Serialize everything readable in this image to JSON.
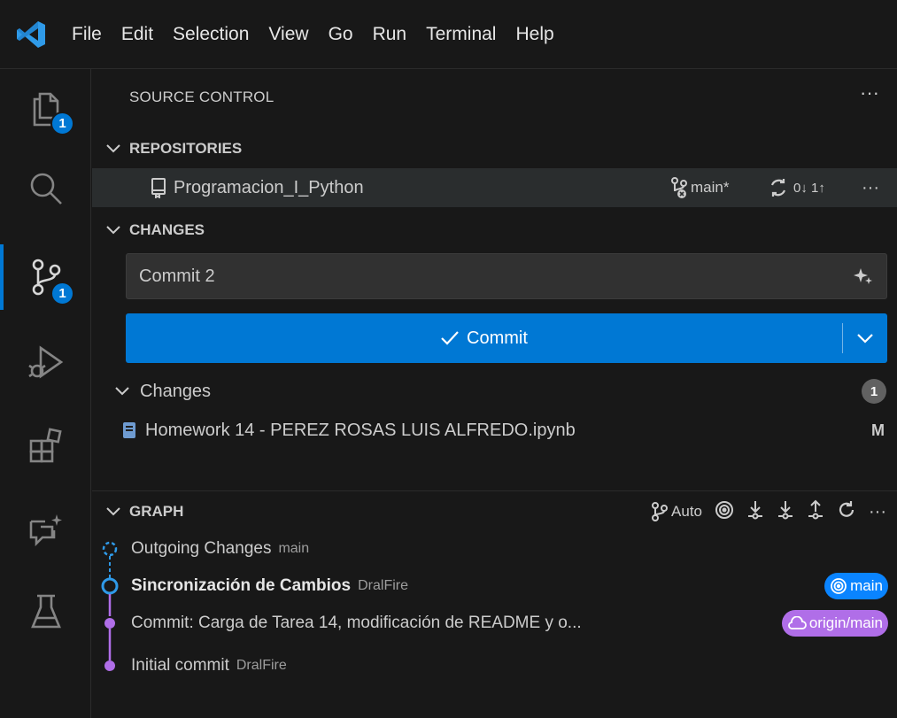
{
  "menu": [
    "File",
    "Edit",
    "Selection",
    "View",
    "Go",
    "Run",
    "Terminal",
    "Help"
  ],
  "activity": {
    "explorer_badge": "1",
    "scm_badge": "1"
  },
  "sidebar": {
    "title": "SOURCE CONTROL",
    "more": "···"
  },
  "repositories": {
    "header": "REPOSITORIES",
    "repo_name": "Programacion_I_Python",
    "branch": "main*",
    "sync": "0↓ 1↑",
    "more": "···"
  },
  "changes": {
    "header": "CHANGES",
    "commit_message": "Commit 2",
    "commit_label": "Commit",
    "group_label": "Changes",
    "count": "1",
    "files": [
      {
        "name": "Homework 14 - PEREZ ROSAS LUIS ALFREDO.ipynb",
        "status": "M"
      }
    ]
  },
  "graph": {
    "header": "GRAPH",
    "auto_label": "Auto",
    "more": "···",
    "rows": [
      {
        "message": "Outgoing Changes",
        "author": "main",
        "bold": false
      },
      {
        "message": "Sincronización de Cambios",
        "author": "DralFire",
        "bold": true,
        "ref": "main"
      },
      {
        "message": "Commit: Carga de Tarea 14, modificación de README y o...",
        "author": "",
        "bold": false,
        "ref": "origin/main"
      },
      {
        "message": "Initial commit",
        "author": "DralFire",
        "bold": false
      }
    ]
  },
  "colors": {
    "accent": "#0078d4",
    "ref_main": "#0a84ff",
    "ref_origin": "#b06ee8"
  }
}
